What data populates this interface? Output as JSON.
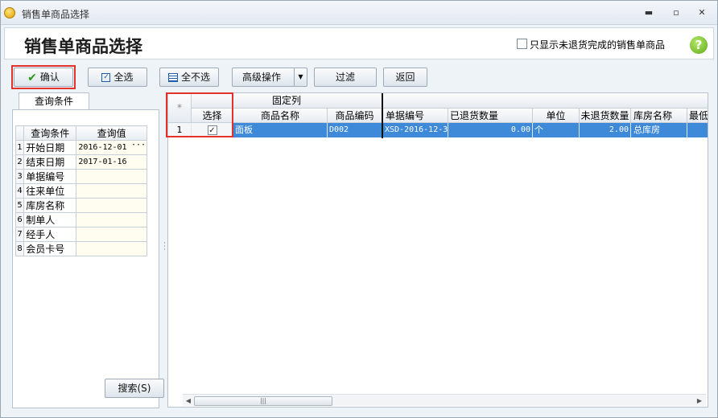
{
  "window": {
    "title": "销售单商品选择",
    "controls": [
      "minimize",
      "maximize",
      "close"
    ]
  },
  "header": {
    "title": "销售单商品选择",
    "only_unreturned_label": "只显示未退货完成的销售单商品",
    "only_unreturned_checked": false,
    "help": "?"
  },
  "toolbar": {
    "confirm": "确认",
    "select_all": "全选",
    "select_none": "全不选",
    "advanced": "高级操作",
    "filter": "过滤",
    "back": "返回"
  },
  "query": {
    "tab": "查询条件",
    "headers": [
      "查询条件",
      "查询值"
    ],
    "rows": [
      {
        "num": "1",
        "label": "开始日期",
        "value": "2016-12-01"
      },
      {
        "num": "2",
        "label": "结束日期",
        "value": "2017-01-16"
      },
      {
        "num": "3",
        "label": "单据编号",
        "value": ""
      },
      {
        "num": "4",
        "label": "往来单位",
        "value": ""
      },
      {
        "num": "5",
        "label": "库房名称",
        "value": ""
      },
      {
        "num": "6",
        "label": "制单人",
        "value": ""
      },
      {
        "num": "7",
        "label": "经手人",
        "value": ""
      },
      {
        "num": "8",
        "label": "会员卡号",
        "value": ""
      }
    ],
    "search_button": "搜索(S)"
  },
  "grid": {
    "frozen_label": "固定列",
    "star": "*",
    "columns": [
      "选择",
      "商品名称",
      "商品编码",
      "单据编号",
      "已退货数量",
      "单位",
      "未退货数量",
      "库房名称",
      "最低"
    ],
    "rows": [
      {
        "num": "1",
        "checked": true,
        "name": "面板",
        "code": "D002",
        "doc": "XSD-2016-12-3",
        "returned": "0.00",
        "unit": "个",
        "unreturned": "2.00",
        "warehouse": "总库房"
      }
    ]
  },
  "colors": {
    "selection": "#3e8ad8",
    "highlight": "#e3312e"
  }
}
